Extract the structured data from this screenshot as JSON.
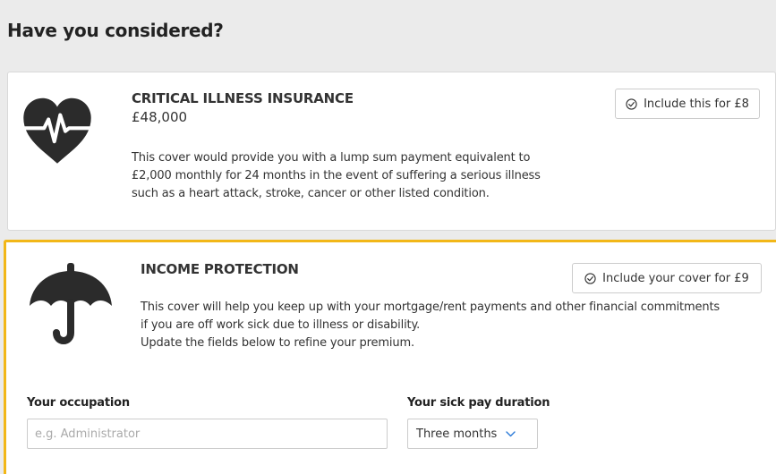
{
  "section": {
    "heading": "Have you considered?"
  },
  "critical_illness": {
    "title": "CRITICAL ILLNESS INSURANCE",
    "amount": "£48,000",
    "description_lines": [
      "This cover would provide you with a lump sum payment equivalent to",
      "£2,000 monthly for 24 months in the event of suffering a serious illness",
      "such as a heart attack, stroke, cancer or other listed condition."
    ],
    "include_label": "Include this for £8",
    "icon": "heart-pulse-icon"
  },
  "income_protection": {
    "title": "INCOME PROTECTION",
    "description_lines": [
      "This cover will help you keep up with your mortgage/rent payments and other financial commitments",
      "if you are off work sick due to illness or disability.",
      "Update the fields below to refine your premium."
    ],
    "include_label": "Include your cover for £9",
    "icon": "umbrella-icon",
    "occupation": {
      "label": "Your occupation",
      "placeholder": "e.g. Administrator",
      "value": ""
    },
    "sick_pay": {
      "label": "Your sick pay duration",
      "selected": "Three months"
    }
  },
  "colors": {
    "highlight_border": "#f2b718",
    "icon": "#2b2b2b",
    "chevron": "#2a7ad8",
    "page_background": "#ebebeb"
  }
}
